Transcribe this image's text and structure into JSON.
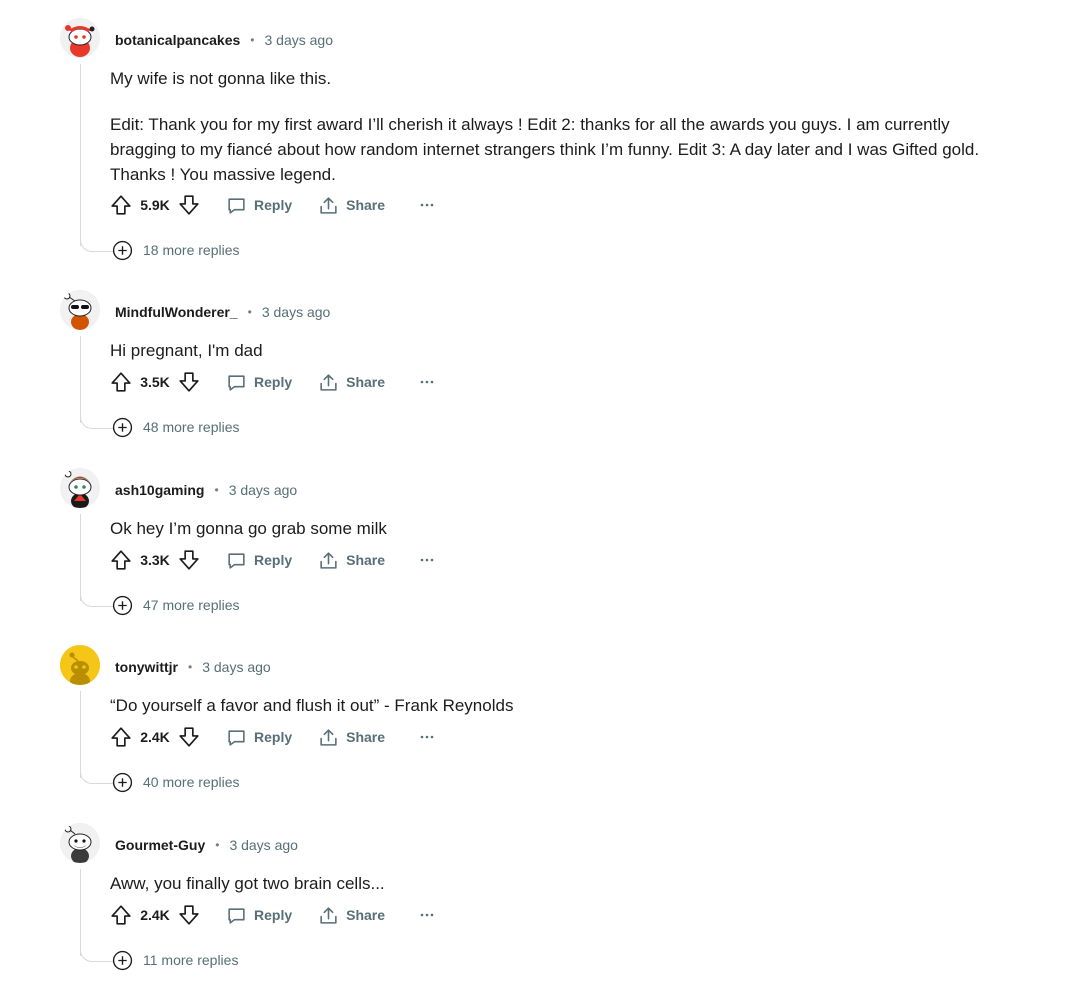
{
  "comments": [
    {
      "author": "botanicalpancakes",
      "time": "3 days ago",
      "avatar_icon": "snoo-red-avatar-icon",
      "paragraphs": [
        "My wife is not gonna like this.",
        "Edit: Thank you for my first award I’ll cherish it always ! Edit 2: thanks for all the awards you guys. I am currently bragging to my fiancé about how random internet strangers think I’m funny. Edit 3: A day later and I was Gifted gold. Thanks ! You massive legend."
      ],
      "score": "5.9K",
      "reply_label": "Reply",
      "share_label": "Share",
      "more_replies": "18 more replies"
    },
    {
      "author": "MindfulWonderer_",
      "time": "3 days ago",
      "avatar_icon": "snoo-sunglasses-avatar-icon",
      "paragraphs": [
        "Hi pregnant, I'm dad"
      ],
      "score": "3.5K",
      "reply_label": "Reply",
      "share_label": "Share",
      "more_replies": "48 more replies"
    },
    {
      "author": "ash10gaming",
      "time": "3 days ago",
      "avatar_icon": "snoo-green-hat-avatar-icon",
      "paragraphs": [
        "Ok hey I’m gonna go grab some milk"
      ],
      "score": "3.3K",
      "reply_label": "Reply",
      "share_label": "Share",
      "more_replies": "47 more replies"
    },
    {
      "author": "tonywittjr",
      "time": "3 days ago",
      "avatar_icon": "snoo-yellow-default-avatar-icon",
      "paragraphs": [
        "“Do yourself a favor and flush it out” - Frank Reynolds"
      ],
      "score": "2.4K",
      "reply_label": "Reply",
      "share_label": "Share",
      "more_replies": "40 more replies"
    },
    {
      "author": "Gourmet-Guy",
      "time": "3 days ago",
      "avatar_icon": "snoo-bearded-avatar-icon",
      "paragraphs": [
        "Aww, you finally got two brain cells..."
      ],
      "score": "2.4K",
      "reply_label": "Reply",
      "share_label": "Share",
      "more_replies": "11 more replies"
    }
  ],
  "colors": {
    "text_primary": "#1c1c1c",
    "text_secondary": "#576f76",
    "thread_line": "#d7dadc",
    "avatar_red": "#e8372b",
    "avatar_yellow": "#f5c518"
  }
}
